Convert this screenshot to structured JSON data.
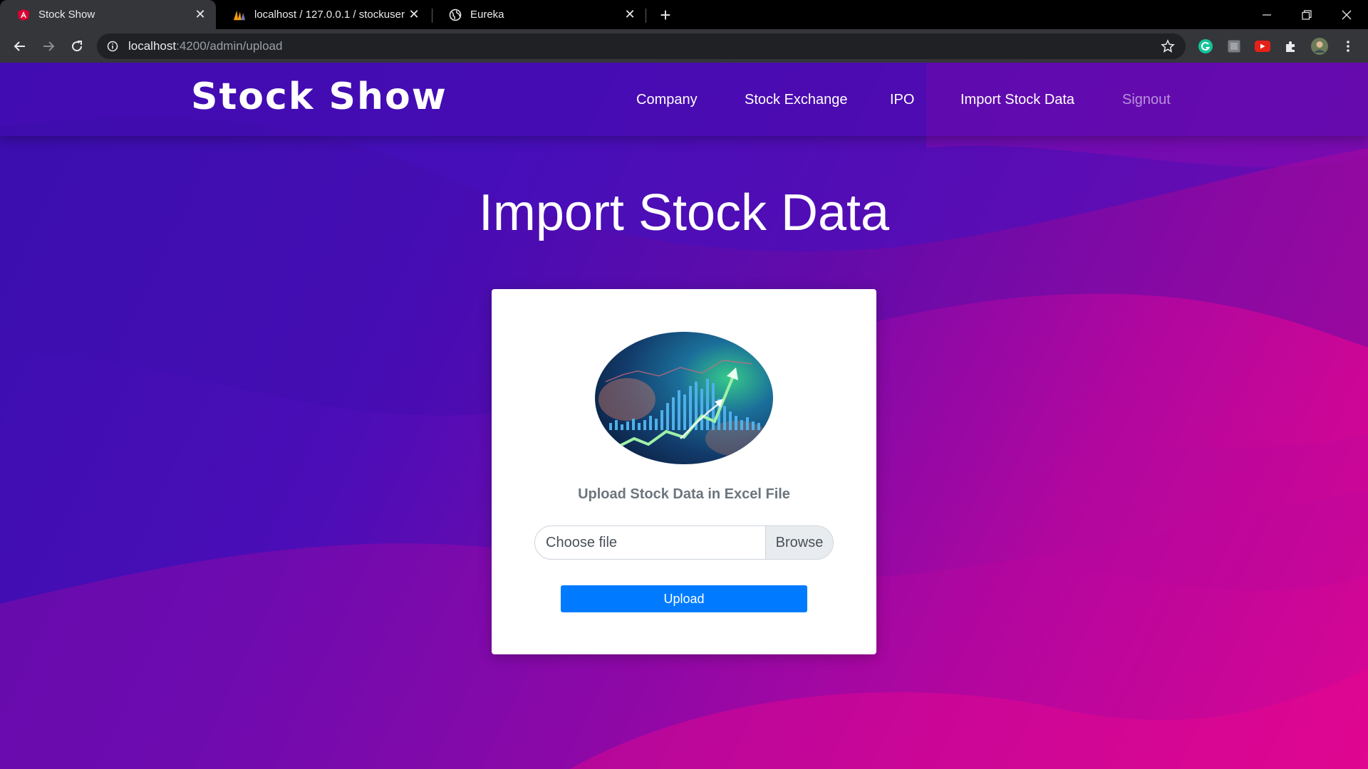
{
  "browser": {
    "tabs": [
      {
        "title": "Stock Show",
        "icon": "angular-icon",
        "active": true
      },
      {
        "title": "localhost / 127.0.0.1 / stockuser /",
        "icon": "phpmyadmin-icon",
        "active": false
      },
      {
        "title": "Eureka",
        "icon": "globe-icon",
        "active": false
      }
    ],
    "url_host": "localhost",
    "url_path": ":4200/admin/upload"
  },
  "app": {
    "brand": "Stock Show",
    "nav": [
      {
        "label": "Company"
      },
      {
        "label": "Stock Exchange"
      },
      {
        "label": "IPO"
      },
      {
        "label": "Import Stock Data"
      },
      {
        "label": "Signout"
      }
    ],
    "page_title": "Import Stock Data",
    "upload_label": "Upload Stock Data in Excel File",
    "file_placeholder": "Choose file",
    "browse_label": "Browse",
    "upload_button": "Upload"
  },
  "colors": {
    "primary_button": "#007bff",
    "gradient_start": "#3a0fb0",
    "gradient_end": "#e2068f"
  }
}
